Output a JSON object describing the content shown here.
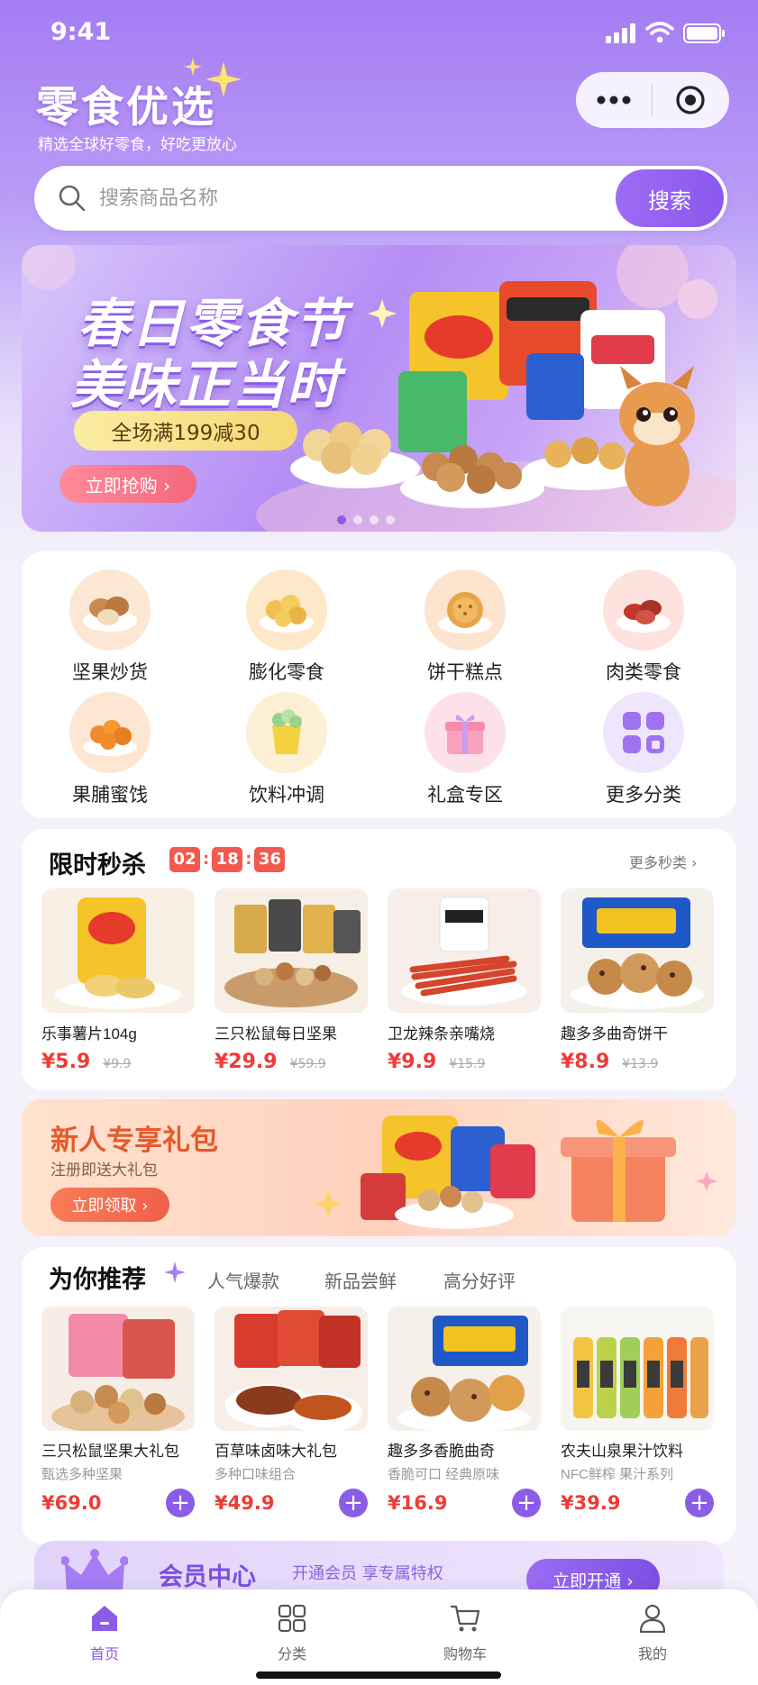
{
  "status": {
    "time": "9:41"
  },
  "header": {
    "brand": "零食优选",
    "slogan": "精选全球好零食，好吃更放心"
  },
  "capsule": {
    "more_icon": "ellipsis-icon",
    "close_icon": "target-icon"
  },
  "search": {
    "placeholder": "搜索商品名称",
    "button": "搜索"
  },
  "banner": {
    "title_line1": "春日零食节",
    "title_line2": "美味正当时",
    "promo": "全场满199减30",
    "cta": "立即抢购 ›",
    "dots": 4,
    "active_dot": 0
  },
  "categories": [
    {
      "label": "坚果炒货",
      "icon": "nuts-icon"
    },
    {
      "label": "膨化零食",
      "icon": "puffed-snack-icon"
    },
    {
      "label": "饼干糕点",
      "icon": "biscuit-icon"
    },
    {
      "label": "肉类零食",
      "icon": "jerky-icon"
    },
    {
      "label": "果脯蜜饯",
      "icon": "dried-fruit-icon"
    },
    {
      "label": "饮料冲调",
      "icon": "drink-icon"
    },
    {
      "label": "礼盒专区",
      "icon": "gift-box-icon"
    },
    {
      "label": "更多分类",
      "icon": "grid-icon"
    }
  ],
  "flash_sale": {
    "title": "限时秒杀",
    "countdown": [
      "02",
      "18",
      "36"
    ],
    "more": "更多秒类 ›",
    "items": [
      {
        "name": "乐事薯片104g",
        "price": "¥5.9",
        "original": "¥9.9",
        "image": "chips-bag-image"
      },
      {
        "name": "三只松鼠每日坚果",
        "price": "¥29.9",
        "original": "¥59.9",
        "image": "mixed-nuts-image"
      },
      {
        "name": "卫龙辣条亲嘴烧",
        "price": "¥9.9",
        "original": "¥15.9",
        "image": "spicy-strips-image"
      },
      {
        "name": "趣多多曲奇饼干",
        "price": "¥8.9",
        "original": "¥13.9",
        "image": "cookies-image"
      }
    ]
  },
  "new_user": {
    "title": "新人专享礼包",
    "subtitle": "注册即送大礼包",
    "cta": "立即领取 ›"
  },
  "recommend": {
    "title": "为你推荐",
    "tabs": [
      "人气爆款",
      "新品尝鲜",
      "高分好评"
    ],
    "items": [
      {
        "name": "三只松鼠坚果大礼包",
        "sub": "甄选多种坚果",
        "price": "¥69.0",
        "image": "nut-gift-pack-image"
      },
      {
        "name": "百草味卤味大礼包",
        "sub": "多种口味组合",
        "price": "¥49.9",
        "image": "braised-snacks-image"
      },
      {
        "name": "趣多多香脆曲奇",
        "sub": "香脆可口 经典原味",
        "price": "¥16.9",
        "image": "crispy-cookies-image"
      },
      {
        "name": "农夫山泉果汁饮料",
        "sub": "NFC鲜榨 果汁系列",
        "price": "¥39.9",
        "image": "juice-bottles-image"
      }
    ]
  },
  "member": {
    "title": "会员中心",
    "subtitle": "开通会员 享专属特权",
    "cta": "立即开通 ›"
  },
  "tabbar": [
    {
      "label": "首页",
      "icon": "home-icon",
      "active": true
    },
    {
      "label": "分类",
      "icon": "category-icon",
      "active": false
    },
    {
      "label": "购物车",
      "icon": "cart-icon",
      "active": false
    },
    {
      "label": "我的",
      "icon": "profile-icon",
      "active": false
    }
  ],
  "colors": {
    "accent": "#8b5ce6",
    "price": "#ef3b36",
    "countdown": "#f25a4f",
    "new_user": "#e55a2b"
  }
}
